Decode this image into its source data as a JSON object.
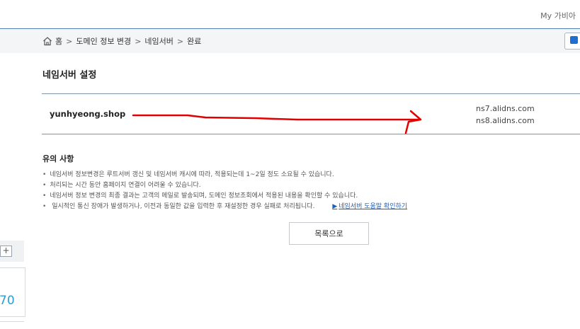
{
  "header": {
    "my_link": "My 가비아"
  },
  "breadcrumb": {
    "items": [
      "홈",
      "도메인 정보 변경",
      "네임서버",
      "완료"
    ],
    "separator": ">"
  },
  "page": {
    "title": "네임서버 설정"
  },
  "result": {
    "domain": "yunhyeong.shop",
    "nameservers": [
      "ns7.alidns.com",
      "ns8.alidns.com"
    ]
  },
  "notice": {
    "title": "유의 사항",
    "items": [
      "네임서버 정보변경은 루트서버 갱신 및 네임서버 캐시에 따라, 적용되는데 1~2일 정도 소요될 수 있습니다.",
      "처리되는 시간 동안 홈페이지 연결이 어려울 수 있습니다.",
      "네임서버 정보 변경의 최종 결과는 고객의 메일로 발송되며, 도메인 정보조회에서 적용된 내용을 확인할 수 있습니다.",
      "일시적인 통신 장애가 발생하거나, 이전과 동일한 값을 입력한 후 재설정한 경우 실패로 처리됩니다."
    ],
    "help_link_arrow": "▶",
    "help_link": "네임서버 도움말 확인하기"
  },
  "buttons": {
    "list": "목록으로"
  },
  "sidebar": {
    "plus": "+",
    "number": "70"
  },
  "colors": {
    "accent": "#1e5fb4",
    "annotation": "#e00000",
    "divider": "#7f93a8",
    "number": "#2a9fd6"
  }
}
